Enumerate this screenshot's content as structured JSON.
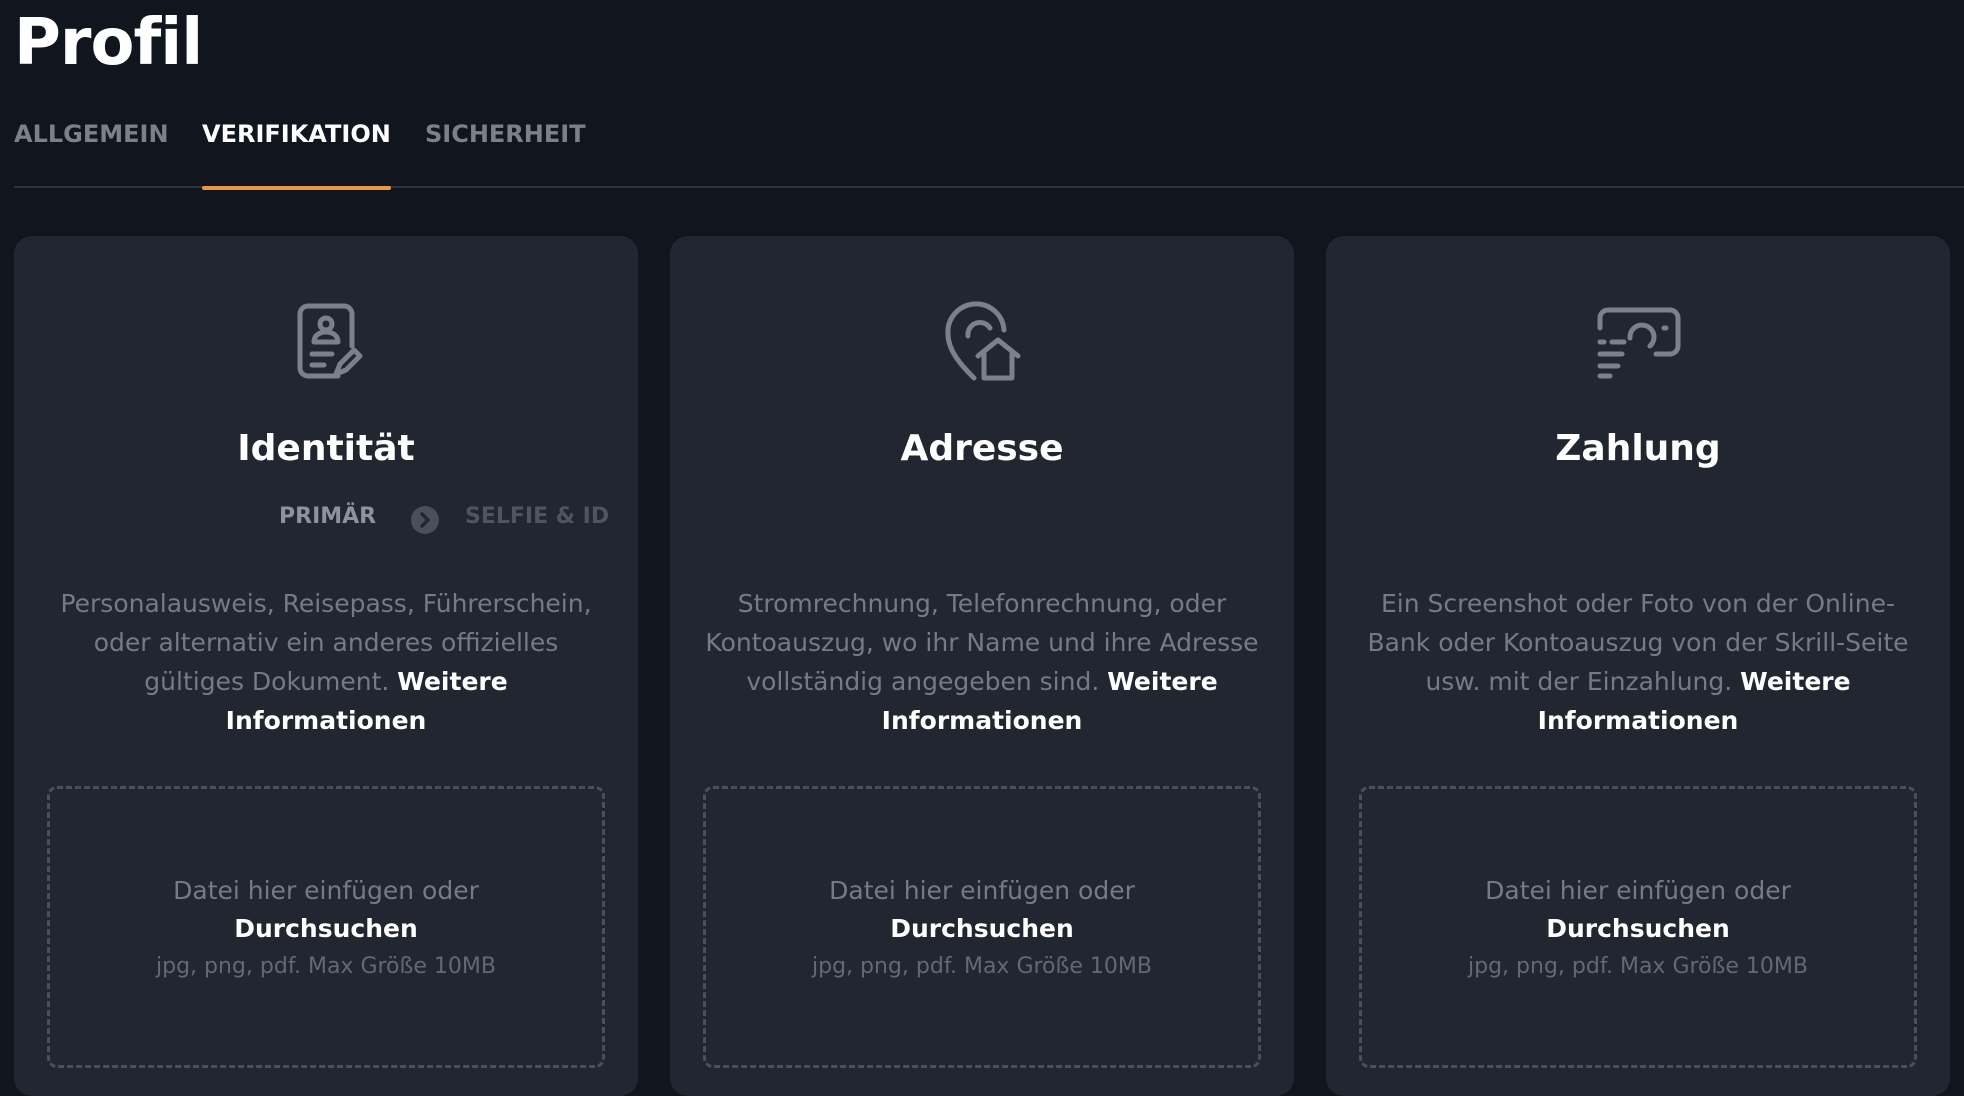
{
  "page": {
    "title": "Profil"
  },
  "tabs": [
    {
      "label": "ALLGEMEIN"
    },
    {
      "label": "VERIFIKATION"
    },
    {
      "label": "SICHERHEIT"
    }
  ],
  "colors": {
    "accent": "#e8964a",
    "background": "#11151d",
    "card": "#222631"
  },
  "cards": [
    {
      "icon": "id-document-icon",
      "title": "Identität",
      "steps": {
        "primary": "PRIMÄR",
        "secondary": "SELFIE & ID"
      },
      "description": "Personalausweis, Reisepass, Führerschein, oder alternativ ein anderes offizielles gültiges Dokument.",
      "more_link": "Weitere Informationen",
      "dropzone": {
        "text": "Datei hier einfügen oder",
        "browse": "Durchsuchen",
        "hint": "jpg, png, pdf. Max Größe 10MB"
      }
    },
    {
      "icon": "location-home-icon",
      "title": "Adresse",
      "description": "Stromrechnung, Telefonrechnung, oder Kontoauszug, wo ihr Name und ihre Adresse vollständig angegeben sind.",
      "more_link": "Weitere Informationen",
      "dropzone": {
        "text": "Datei hier einfügen oder",
        "browse": "Durchsuchen",
        "hint": "jpg, png, pdf. Max Größe 10MB"
      }
    },
    {
      "icon": "payment-screen-icon",
      "title": "Zahlung",
      "description": "Ein Screenshot oder Foto von der Online-Bank oder Kontoauszug von der Skrill-Seite usw. mit der Einzahlung.",
      "more_link": "Weitere Informationen",
      "dropzone": {
        "text": "Datei hier einfügen oder",
        "browse": "Durchsuchen",
        "hint": "jpg, png, pdf. Max Größe 10MB"
      }
    }
  ]
}
